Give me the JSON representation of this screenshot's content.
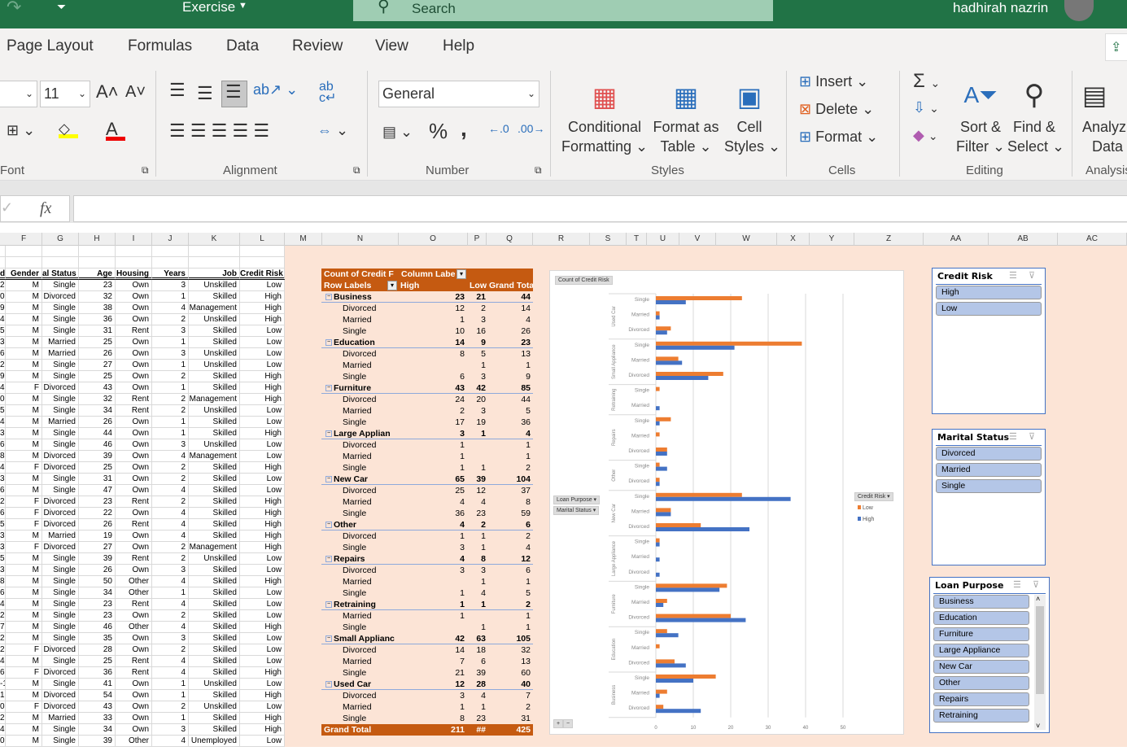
{
  "titlebar": {
    "file_name": "Exercise",
    "search_placeholder": "Search",
    "user_name": "hadhirah nazrin"
  },
  "tabs": [
    "Page Layout",
    "Formulas",
    "Data",
    "Review",
    "View",
    "Help"
  ],
  "ribbon": {
    "font": {
      "size": "11",
      "group": "Font"
    },
    "alignment": {
      "group": "Alignment"
    },
    "number": {
      "format": "General",
      "group": "Number",
      "percent": "%",
      "comma": ","
    },
    "styles": {
      "conditional": [
        "Conditional",
        "Formatting ⌄"
      ],
      "format_table": [
        "Format as",
        "Table ⌄"
      ],
      "cell_styles": [
        "Cell",
        "Styles ⌄"
      ],
      "group": "Styles"
    },
    "cells": {
      "insert": "Insert",
      "delete": "Delete",
      "format": "Format",
      "group": "Cells"
    },
    "editing": {
      "sort": [
        "Sort &",
        "Filter ⌄"
      ],
      "find": [
        "Find &",
        "Select ⌄"
      ],
      "group": "Editing"
    },
    "analysis": {
      "analyze": [
        "Analyz",
        "Data"
      ],
      "group": "Analysis"
    }
  },
  "formula_bar": {
    "fx": "fx",
    "value": ""
  },
  "columns": [
    "F",
    "G",
    "H",
    "I",
    "J",
    "K",
    "L",
    "M",
    "N",
    "O",
    "P",
    "Q",
    "R",
    "S",
    "T",
    "U",
    "V",
    "W",
    "X",
    "Y",
    "Z",
    "AA",
    "AB",
    "AC"
  ],
  "table": {
    "headers": [
      "d",
      "Gender",
      "al Status",
      "Age",
      "Housing",
      "Years",
      "Job",
      "Credit Risk"
    ],
    "rows": [
      [
        "2",
        "M",
        "Single",
        "23",
        "Own",
        "3",
        "Unskilled",
        "Low"
      ],
      [
        "0",
        "M",
        "Divorced",
        "32",
        "Own",
        "1",
        "Skilled",
        "High"
      ],
      [
        "9",
        "M",
        "Single",
        "38",
        "Own",
        "4",
        "Management",
        "High"
      ],
      [
        "4",
        "M",
        "Single",
        "36",
        "Own",
        "2",
        "Unskilled",
        "High"
      ],
      [
        "5",
        "M",
        "Single",
        "31",
        "Rent",
        "3",
        "Skilled",
        "Low"
      ],
      [
        "3",
        "M",
        "Married",
        "25",
        "Own",
        "1",
        "Skilled",
        "Low"
      ],
      [
        "6",
        "M",
        "Married",
        "26",
        "Own",
        "3",
        "Unskilled",
        "Low"
      ],
      [
        "2",
        "M",
        "Single",
        "27",
        "Own",
        "1",
        "Unskilled",
        "Low"
      ],
      [
        "9",
        "M",
        "Single",
        "25",
        "Own",
        "2",
        "Skilled",
        "High"
      ],
      [
        "4",
        "F",
        "Divorced",
        "43",
        "Own",
        "1",
        "Skilled",
        "High"
      ],
      [
        "0",
        "M",
        "Single",
        "32",
        "Rent",
        "2",
        "Management",
        "High"
      ],
      [
        "5",
        "M",
        "Single",
        "34",
        "Rent",
        "2",
        "Unskilled",
        "Low"
      ],
      [
        "4",
        "M",
        "Married",
        "26",
        "Own",
        "1",
        "Skilled",
        "Low"
      ],
      [
        "3",
        "M",
        "Single",
        "44",
        "Own",
        "1",
        "Skilled",
        "High"
      ],
      [
        "6",
        "M",
        "Single",
        "46",
        "Own",
        "3",
        "Unskilled",
        "Low"
      ],
      [
        "8",
        "M",
        "Divorced",
        "39",
        "Own",
        "4",
        "Management",
        "Low"
      ],
      [
        "4",
        "F",
        "Divorced",
        "25",
        "Own",
        "2",
        "Skilled",
        "High"
      ],
      [
        "3",
        "M",
        "Single",
        "31",
        "Own",
        "2",
        "Skilled",
        "Low"
      ],
      [
        "6",
        "M",
        "Single",
        "47",
        "Own",
        "4",
        "Skilled",
        "Low"
      ],
      [
        "2",
        "F",
        "Divorced",
        "23",
        "Rent",
        "2",
        "Skilled",
        "High"
      ],
      [
        "6",
        "F",
        "Divorced",
        "22",
        "Own",
        "4",
        "Skilled",
        "High"
      ],
      [
        "5",
        "F",
        "Divorced",
        "26",
        "Rent",
        "4",
        "Skilled",
        "High"
      ],
      [
        "3",
        "M",
        "Married",
        "19",
        "Own",
        "4",
        "Skilled",
        "High"
      ],
      [
        "3",
        "F",
        "Divorced",
        "27",
        "Own",
        "2",
        "Management",
        "High"
      ],
      [
        "5",
        "M",
        "Single",
        "39",
        "Rent",
        "2",
        "Unskilled",
        "Low"
      ],
      [
        "3",
        "M",
        "Single",
        "26",
        "Own",
        "3",
        "Skilled",
        "Low"
      ],
      [
        "8",
        "M",
        "Single",
        "50",
        "Other",
        "4",
        "Skilled",
        "High"
      ],
      [
        "6",
        "M",
        "Single",
        "34",
        "Other",
        "1",
        "Skilled",
        "Low"
      ],
      [
        "4",
        "M",
        "Single",
        "23",
        "Rent",
        "4",
        "Skilled",
        "Low"
      ],
      [
        "2",
        "M",
        "Single",
        "23",
        "Own",
        "2",
        "Skilled",
        "Low"
      ],
      [
        "7",
        "M",
        "Single",
        "46",
        "Other",
        "4",
        "Skilled",
        "High"
      ],
      [
        "2",
        "M",
        "Single",
        "35",
        "Own",
        "3",
        "Skilled",
        "Low"
      ],
      [
        "2",
        "F",
        "Divorced",
        "28",
        "Own",
        "2",
        "Skilled",
        "Low"
      ],
      [
        "4",
        "M",
        "Single",
        "25",
        "Rent",
        "4",
        "Skilled",
        "Low"
      ],
      [
        "6",
        "F",
        "Divorced",
        "36",
        "Rent",
        "4",
        "Skilled",
        "High"
      ],
      [
        "-1",
        "M",
        "Single",
        "41",
        "Own",
        "1",
        "Unskilled",
        "Low"
      ],
      [
        "1",
        "M",
        "Divorced",
        "54",
        "Own",
        "1",
        "Skilled",
        "High"
      ],
      [
        "0",
        "F",
        "Divorced",
        "43",
        "Own",
        "2",
        "Unskilled",
        "Low"
      ],
      [
        "2",
        "M",
        "Married",
        "33",
        "Own",
        "1",
        "Skilled",
        "High"
      ],
      [
        "4",
        "M",
        "Single",
        "34",
        "Own",
        "3",
        "Skilled",
        "High"
      ],
      [
        "0",
        "M",
        "Single",
        "39",
        "Other",
        "4",
        "Unemployed",
        "Low"
      ]
    ]
  },
  "pivot": {
    "header1": [
      "Count of Credit F",
      "Column Labe"
    ],
    "header2": [
      "Row Labels",
      "High",
      "Low",
      "Grand Total"
    ],
    "groups": [
      {
        "label": "Business",
        "high": "23",
        "low": "21",
        "total": "44",
        "rows": [
          [
            "Divorced",
            "12",
            "2",
            "14"
          ],
          [
            "Married",
            "1",
            "3",
            "4"
          ],
          [
            "Single",
            "10",
            "16",
            "26"
          ]
        ]
      },
      {
        "label": "Education",
        "high": "14",
        "low": "9",
        "total": "23",
        "rows": [
          [
            "Divorced",
            "8",
            "5",
            "13"
          ],
          [
            "Married",
            "",
            "1",
            "1"
          ],
          [
            "Single",
            "6",
            "3",
            "9"
          ]
        ]
      },
      {
        "label": "Furniture",
        "high": "43",
        "low": "42",
        "total": "85",
        "rows": [
          [
            "Divorced",
            "24",
            "20",
            "44"
          ],
          [
            "Married",
            "2",
            "3",
            "5"
          ],
          [
            "Single",
            "17",
            "19",
            "36"
          ]
        ]
      },
      {
        "label": "Large Applian",
        "high": "3",
        "low": "1",
        "total": "4",
        "rows": [
          [
            "Divorced",
            "1",
            "",
            "1"
          ],
          [
            "Married",
            "1",
            "",
            "1"
          ],
          [
            "Single",
            "1",
            "1",
            "2"
          ]
        ]
      },
      {
        "label": "New Car",
        "high": "65",
        "low": "39",
        "total": "104",
        "rows": [
          [
            "Divorced",
            "25",
            "12",
            "37"
          ],
          [
            "Married",
            "4",
            "4",
            "8"
          ],
          [
            "Single",
            "36",
            "23",
            "59"
          ]
        ]
      },
      {
        "label": "Other",
        "high": "4",
        "low": "2",
        "total": "6",
        "rows": [
          [
            "Divorced",
            "1",
            "1",
            "2"
          ],
          [
            "Single",
            "3",
            "1",
            "4"
          ]
        ]
      },
      {
        "label": "Repairs",
        "high": "4",
        "low": "8",
        "total": "12",
        "rows": [
          [
            "Divorced",
            "3",
            "3",
            "6"
          ],
          [
            "Married",
            "",
            "1",
            "1"
          ],
          [
            "Single",
            "1",
            "4",
            "5"
          ]
        ]
      },
      {
        "label": "Retraining",
        "high": "1",
        "low": "1",
        "total": "2",
        "rows": [
          [
            "Married",
            "1",
            "",
            "1"
          ],
          [
            "Single",
            "",
            "1",
            "1"
          ]
        ]
      },
      {
        "label": "Small Applianc",
        "high": "42",
        "low": "63",
        "total": "105",
        "rows": [
          [
            "Divorced",
            "14",
            "18",
            "32"
          ],
          [
            "Married",
            "7",
            "6",
            "13"
          ],
          [
            "Single",
            "21",
            "39",
            "60"
          ]
        ]
      },
      {
        "label": "Used Car",
        "high": "12",
        "low": "28",
        "total": "40",
        "rows": [
          [
            "Divorced",
            "3",
            "4",
            "7"
          ],
          [
            "Married",
            "1",
            "1",
            "2"
          ],
          [
            "Single",
            "8",
            "23",
            "31"
          ]
        ]
      }
    ],
    "grand_total": [
      "Grand Total",
      "211",
      "##",
      "425"
    ]
  },
  "chart_data": {
    "type": "bar",
    "orientation": "horizontal",
    "value_field_button": "Count of Credit Risk",
    "row_field_buttons": [
      "Loan Purpose",
      "Marital Status"
    ],
    "legend_field_button": "Credit Risk",
    "legend_placement": "right",
    "xlim": [
      0,
      50
    ],
    "xticks": [
      "0",
      "10",
      "20",
      "30",
      "40",
      "50"
    ],
    "grid": true,
    "colors": {
      "Low": "#ed7d31",
      "High": "#4472c4"
    },
    "series_names": [
      "Low",
      "High"
    ],
    "groups": [
      {
        "name": "Used Car",
        "cats": [
          "Single",
          "Married",
          "Divorced"
        ],
        "low": [
          23,
          1,
          4
        ],
        "high": [
          8,
          1,
          3
        ]
      },
      {
        "name": "Small Appliance",
        "cats": [
          "Single",
          "Married",
          "Divorced"
        ],
        "low": [
          39,
          6,
          18
        ],
        "high": [
          21,
          7,
          14
        ]
      },
      {
        "name": "Retraining",
        "cats": [
          "Single",
          "Married"
        ],
        "low": [
          1,
          0
        ],
        "high": [
          0,
          1
        ]
      },
      {
        "name": "Repairs",
        "cats": [
          "Single",
          "Married",
          "Divorced"
        ],
        "low": [
          4,
          1,
          3
        ],
        "high": [
          1,
          0,
          3
        ]
      },
      {
        "name": "Other",
        "cats": [
          "Single",
          "Divorced"
        ],
        "low": [
          1,
          1
        ],
        "high": [
          3,
          1
        ]
      },
      {
        "name": "New Car",
        "cats": [
          "Single",
          "Married",
          "Divorced"
        ],
        "low": [
          23,
          4,
          12
        ],
        "high": [
          36,
          4,
          25
        ]
      },
      {
        "name": "Large Appliance",
        "cats": [
          "Single",
          "Married",
          "Divorced"
        ],
        "low": [
          1,
          0,
          0
        ],
        "high": [
          1,
          1,
          1
        ]
      },
      {
        "name": "Furniture",
        "cats": [
          "Single",
          "Married",
          "Divorced"
        ],
        "low": [
          19,
          3,
          20
        ],
        "high": [
          17,
          2,
          24
        ]
      },
      {
        "name": "Education",
        "cats": [
          "Single",
          "Married",
          "Divorced"
        ],
        "low": [
          3,
          1,
          5
        ],
        "high": [
          6,
          0,
          8
        ]
      },
      {
        "name": "Business",
        "cats": [
          "Single",
          "Married",
          "Divorced"
        ],
        "low": [
          16,
          3,
          2
        ],
        "high": [
          10,
          1,
          12
        ]
      }
    ]
  },
  "slicers": [
    {
      "title": "Credit Risk",
      "items": [
        "High",
        "Low"
      ]
    },
    {
      "title": "Marital Status",
      "items": [
        "Divorced",
        "Married",
        "Single"
      ]
    },
    {
      "title": "Loan Purpose",
      "items": [
        "Business",
        "Education",
        "Furniture",
        "Large Appliance",
        "New Car",
        "Other",
        "Repairs",
        "Retraining"
      ]
    }
  ]
}
